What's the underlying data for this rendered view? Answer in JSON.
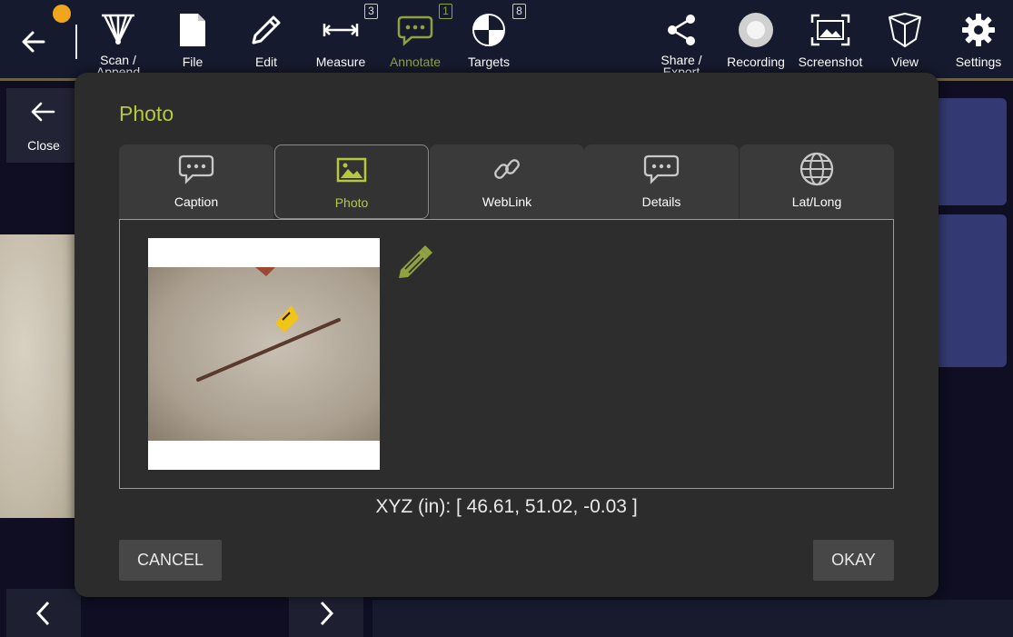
{
  "toolbar": {
    "items": [
      {
        "label": "Scan /\nAppend",
        "icon": "scan-icon"
      },
      {
        "label": "File",
        "icon": "file-icon"
      },
      {
        "label": "Edit",
        "icon": "pencil-icon"
      },
      {
        "label": "Measure",
        "icon": "measure-icon",
        "badge": "3"
      },
      {
        "label": "Annotate",
        "icon": "annotate-icon",
        "badge": "1",
        "active": true
      },
      {
        "label": "Targets",
        "icon": "target-icon",
        "badge": "8"
      },
      {
        "label": "Share /\nExport",
        "icon": "share-icon"
      },
      {
        "label": "Recording",
        "icon": "record-icon"
      },
      {
        "label": "Screenshot",
        "icon": "screenshot-icon"
      },
      {
        "label": "View",
        "icon": "view-cube-icon"
      },
      {
        "label": "Settings",
        "icon": "gear-icon"
      }
    ]
  },
  "side": {
    "close_label": "Close"
  },
  "dialog": {
    "title": "Photo",
    "tabs": [
      {
        "label": "Caption",
        "icon": "speech-bubble-icon"
      },
      {
        "label": "Photo",
        "icon": "image-icon",
        "active": true
      },
      {
        "label": "WebLink",
        "icon": "link-icon"
      },
      {
        "label": "Details",
        "icon": "speech-bubble-icon"
      },
      {
        "label": "Lat/Long",
        "icon": "globe-icon"
      }
    ],
    "xyz": "XYZ (in): [ 46.61, 51.02, -0.03 ]",
    "cancel_label": "CANCEL",
    "okay_label": "OKAY"
  },
  "colors": {
    "accent": "#b6c93d",
    "toolbar_bg": "#161a2e",
    "dialog_bg": "#2c2c2c",
    "badge_dot": "#f0a61c"
  }
}
